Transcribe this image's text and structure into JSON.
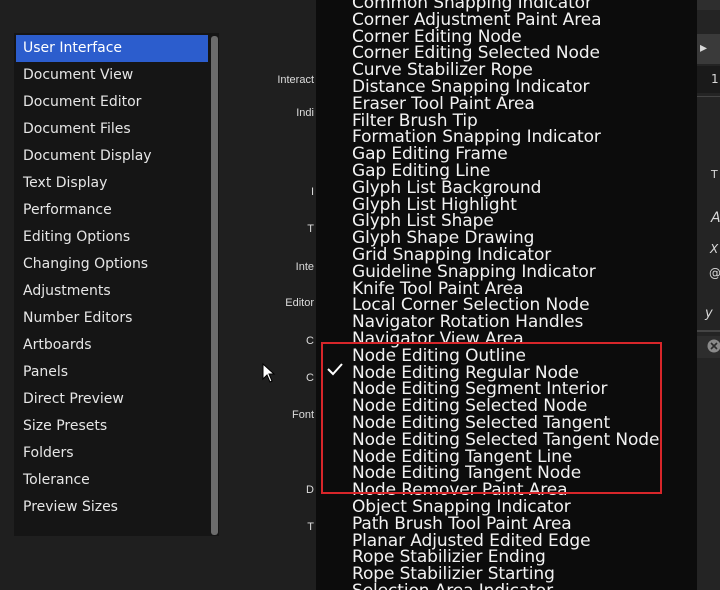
{
  "sidebar": {
    "items": [
      {
        "label": "User Interface",
        "selected": true
      },
      {
        "label": "Document View"
      },
      {
        "label": "Document Editor"
      },
      {
        "label": "Document Files"
      },
      {
        "label": "Document Display"
      },
      {
        "label": "Text Display"
      },
      {
        "label": "Performance"
      },
      {
        "label": "Editing Options"
      },
      {
        "label": "Changing Options"
      },
      {
        "label": "Adjustments"
      },
      {
        "label": "Number Editors"
      },
      {
        "label": "Artboards"
      },
      {
        "label": "Panels"
      },
      {
        "label": "Direct Preview"
      },
      {
        "label": "Size Presets"
      },
      {
        "label": "Folders"
      },
      {
        "label": "Tolerance"
      },
      {
        "label": "Preview Sizes"
      }
    ]
  },
  "settings_labels": [
    {
      "text": "Interact"
    },
    {
      "text": "Indi"
    },
    {
      "text": "I"
    },
    {
      "text": "T"
    },
    {
      "text": "Inte"
    },
    {
      "text": "Editor"
    },
    {
      "text": "C"
    },
    {
      "text": "C"
    },
    {
      "text": "Font"
    },
    {
      "text": "D"
    },
    {
      "text": "T"
    }
  ],
  "dropdown": {
    "selected_item": "Node Editing Regular Node",
    "items": [
      "Common Snapping Indicator",
      "Corner Adjustment Paint Area",
      "Corner Editing Node",
      "Corner Editing Selected Node",
      "Curve Stabilizer Rope",
      "Distance Snapping Indicator",
      "Eraser Tool Paint Area",
      "Filter Brush Tip",
      "Formation Snapping Indicator",
      "Gap Editing Frame",
      "Gap Editing Line",
      "Glyph List Background",
      "Glyph List Highlight",
      "Glyph List Shape",
      "Glyph Shape Drawing",
      "Grid Snapping Indicator",
      "Guideline Snapping Indicator",
      "Knife Tool Paint Area",
      "Local Corner Selection Node",
      "Navigator Rotation Handles",
      "Navigator View Area",
      "Node Editing Outline",
      "Node Editing Regular Node",
      "Node Editing Segment Interior",
      "Node Editing Selected Node",
      "Node Editing Selected Tangent",
      "Node Editing Selected Tangent Node",
      "Node Editing Tangent Line",
      "Node Editing Tangent Node",
      "Node Remover Paint Area",
      "Object Snapping Indicator",
      "Path Brush Tool Paint Area",
      "Planar Adjusted Edited Edge",
      "Rope Stabilizier Ending",
      "Rope Stabilizier Starting",
      "Selection Area Indicator"
    ]
  },
  "right_panel": {
    "field_value": "1",
    "glyphs": [
      "T",
      "A",
      "X",
      "@",
      "y"
    ]
  },
  "colors": {
    "selection": "#2c5dcd",
    "highlight_border": "#d8262a",
    "dropdown_bg": "#0c0c0c"
  }
}
